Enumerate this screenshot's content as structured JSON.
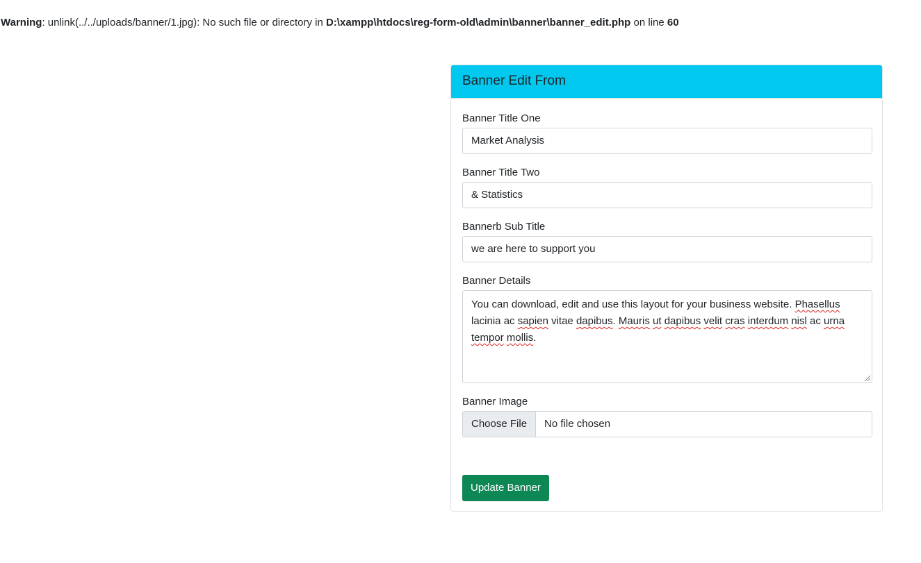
{
  "warning": {
    "label": "Warning",
    "message_a": ": unlink(../../uploads/banner/1.jpg): No such file or directory in ",
    "path": "D:\\xampp\\htdocs\\reg-form-old\\admin\\banner\\banner_edit.php",
    "message_b": " on line ",
    "line": "60"
  },
  "card": {
    "title": "Banner Edit From",
    "header_color": "#00c8ee"
  },
  "fields": {
    "title_one": {
      "label": "Banner Title One",
      "value": "Market Analysis"
    },
    "title_two": {
      "label": "Banner Title Two",
      "value": "& Statistics"
    },
    "sub_title": {
      "label": "Bannerb Sub Title",
      "value": "we are here to support you"
    },
    "details": {
      "label": "Banner Details",
      "text_1": "You can download, edit and use this layout for your business website. ",
      "w_phasellus": "Phasellus",
      "text_2": " lacinia ac ",
      "w_sapien": "sapien",
      "text_3": " vitae ",
      "w_dapibus": "dapibus",
      "text_4": ". ",
      "w_mauris": "Mauris",
      "text_5": " ",
      "w_ut": "ut",
      "text_6": " ",
      "w_dapibus2": "dapibus",
      "text_7": " ",
      "w_velit": "velit",
      "text_8": " ",
      "w_cras": "cras",
      "text_9": " ",
      "w_interdum": "interdum",
      "text_10": " ",
      "w_nisl": "nisl",
      "text_11": " ac ",
      "w_urna": "urna",
      "text_12": " ",
      "w_tempor": "tempor",
      "text_13": " ",
      "w_mollis": "mollis",
      "text_14": "."
    },
    "image": {
      "label": "Banner Image",
      "button": "Choose File",
      "status": "No file chosen"
    }
  },
  "submit": {
    "label": "Update Banner",
    "color": "#0d8753"
  }
}
